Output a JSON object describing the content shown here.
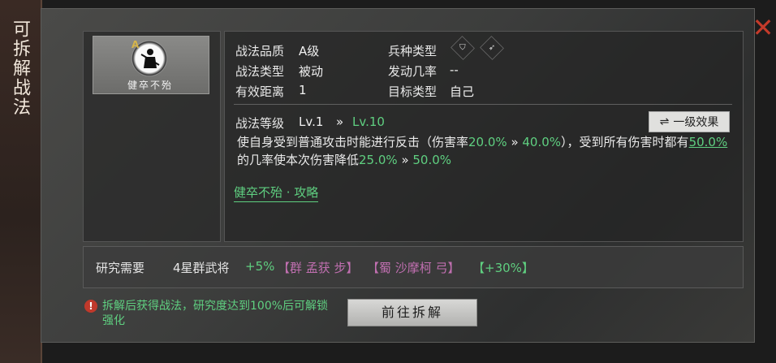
{
  "side_title": "可拆解战法",
  "close_symbol": "✕",
  "tactic": {
    "name": "健卒不殆",
    "grade_badge": "A",
    "quality_label": "战法品质",
    "quality_value": "A级",
    "type_label": "战法类型",
    "type_value": "被动",
    "range_label": "有效距离",
    "range_value": "1",
    "unit_label": "兵种类型",
    "unit_icons": [
      "shield-icon",
      "bow-icon"
    ],
    "trigger_label": "发动几率",
    "trigger_value": "--",
    "target_label": "目标类型",
    "target_value": "自己"
  },
  "level": {
    "label": "战法等级",
    "current": "Lv.1",
    "arrow": "»",
    "max": "Lv.10"
  },
  "effect_button": {
    "icon": "⇌",
    "label": "一级效果"
  },
  "description": {
    "p1": "使自身受到普通攻击时能进行反击（伤害率",
    "v1": "20.0%",
    "a1": " » ",
    "v2": "40.0%",
    "p2": "），受到所有伤害时都有",
    "v3": "50.0%",
    "p3": "的几率使本次伤害降低",
    "v4": "25.0%",
    "a2": " » ",
    "v5": "50.0%"
  },
  "guide_link": "健卒不殆 · 攻略",
  "research": {
    "label": "研究需要",
    "condition": "4星群武将",
    "bonus": "+5%",
    "general_1": "【群 孟获 步】",
    "general_2": "【蜀 沙摩柯 弓】",
    "extra": "【+30%】"
  },
  "warning": {
    "icon": "!",
    "text": "拆解后获得战法，研究度达到100%后可解锁强化"
  },
  "action_button": "前往拆解",
  "colors": {
    "accent_green": "#5fcf80",
    "general_purple": "#c06fb0",
    "close_red": "#c43a2a"
  }
}
